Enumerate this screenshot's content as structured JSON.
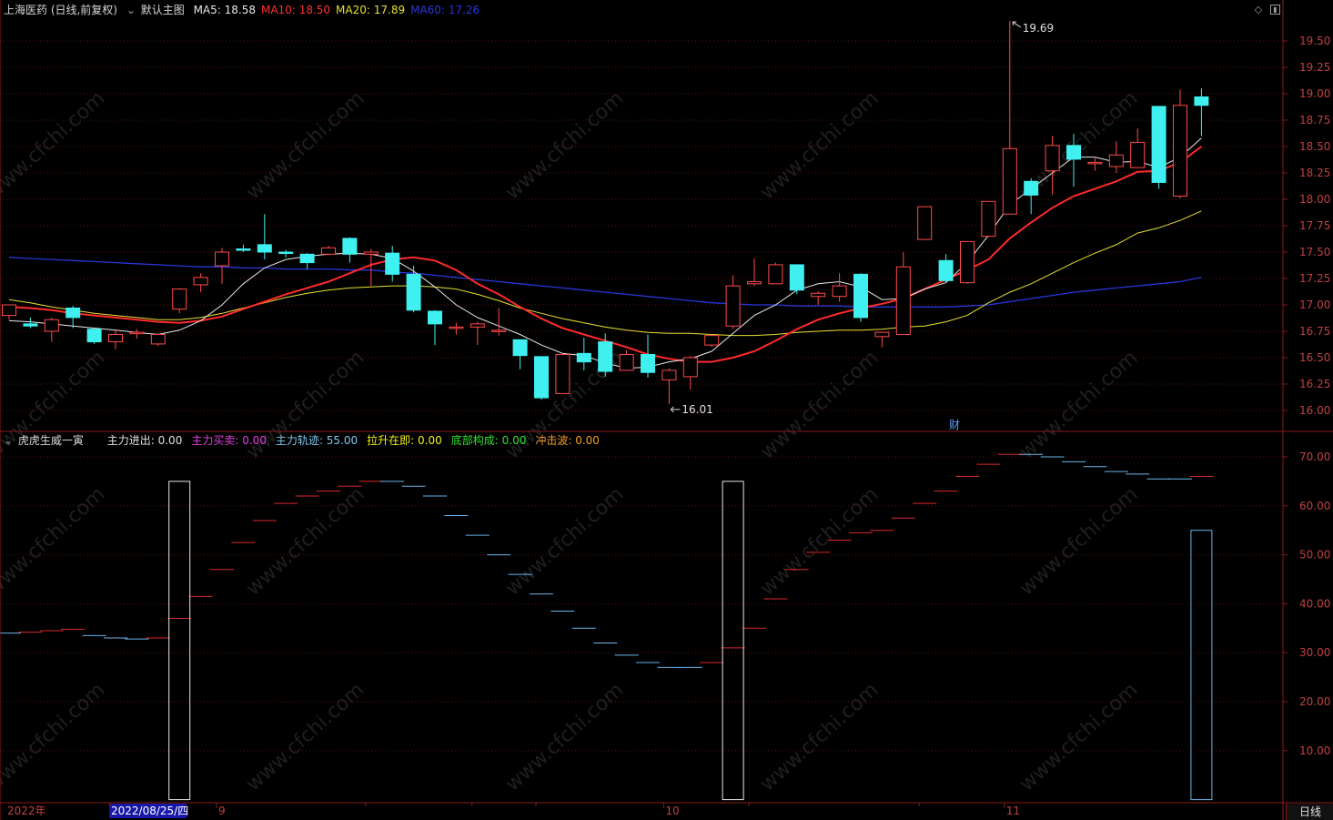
{
  "stock": {
    "title": "上海医药 (日线,前复权)",
    "main_chart_label": "默认主图",
    "ma": [
      {
        "name": "MA5",
        "value": "18.58",
        "color": "#e8e8e8"
      },
      {
        "name": "MA10",
        "value": "18.50",
        "color": "#ff3030"
      },
      {
        "name": "MA20",
        "value": "17.89",
        "color": "#e8e030"
      },
      {
        "name": "MA60",
        "value": "17.26",
        "color": "#2a36d8"
      }
    ]
  },
  "indicator": {
    "title": "虎虎生威一寅",
    "fields": [
      {
        "name": "主力进出",
        "value": "0.00",
        "color": "#e0e0e0"
      },
      {
        "name": "主力买卖",
        "value": "0.00",
        "color": "#e040e0"
      },
      {
        "name": "主力轨迹",
        "value": "55.00",
        "color": "#7ec8f0"
      },
      {
        "name": "拉升在即",
        "value": "0.00",
        "color": "#f0f020"
      },
      {
        "name": "底部构成",
        "value": "0.00",
        "color": "#30e030"
      },
      {
        "name": "冲击波",
        "value": "0.00",
        "color": "#f0a030"
      }
    ]
  },
  "annotations": {
    "high": "19.69",
    "low": "16.01",
    "finance_marker": "财"
  },
  "time_axis": {
    "year_label": "2022年",
    "cursor_date": "2022/08/25/四",
    "months": [
      "9",
      "10",
      "11"
    ],
    "period_label": "日线"
  },
  "watermark": "www.cfchi.com",
  "colors": {
    "up": "#ff4a4a",
    "down": "#40f0f0",
    "grid": "#5a1010",
    "axis": "#8b1a1a",
    "axis_text": "#c04040"
  },
  "chart_data": [
    {
      "type": "candlestick",
      "title": "上海医药 (日线,前复权)",
      "y_ticks": [
        "19.50",
        "19.25",
        "19.00",
        "18.75",
        "18.50",
        "18.25",
        "18.00",
        "17.75",
        "17.50",
        "17.25",
        "17.00",
        "16.75",
        "16.50",
        "16.25",
        "16.00"
      ],
      "ylim": [
        15.95,
        19.75
      ],
      "candles": [
        [
          16.9,
          17.0,
          16.86,
          16.98
        ],
        [
          16.82,
          16.8,
          16.78,
          16.88
        ],
        [
          16.75,
          16.86,
          16.65,
          16.88
        ],
        [
          16.97,
          16.88,
          16.78,
          16.99
        ],
        [
          16.77,
          16.65,
          16.63,
          16.77
        ],
        [
          16.65,
          16.72,
          16.58,
          16.76
        ],
        [
          16.74,
          16.74,
          16.68,
          16.77
        ],
        [
          16.63,
          16.72,
          16.61,
          16.73
        ],
        [
          16.96,
          17.15,
          16.92,
          17.16
        ],
        [
          17.19,
          17.26,
          17.12,
          17.3
        ],
        [
          17.37,
          17.5,
          17.2,
          17.54
        ],
        [
          17.53,
          17.52,
          17.5,
          17.57
        ],
        [
          17.57,
          17.5,
          17.43,
          17.86
        ],
        [
          17.5,
          17.49,
          17.45,
          17.52
        ],
        [
          17.48,
          17.4,
          17.34,
          17.49
        ],
        [
          17.48,
          17.54,
          17.47,
          17.56
        ],
        [
          17.63,
          17.48,
          17.4,
          17.64
        ],
        [
          17.48,
          17.5,
          17.18,
          17.53
        ],
        [
          17.49,
          17.29,
          17.22,
          17.56
        ],
        [
          17.29,
          16.95,
          16.93,
          17.37
        ],
        [
          16.94,
          16.82,
          16.62,
          16.95
        ],
        [
          16.78,
          16.79,
          16.72,
          16.83
        ],
        [
          16.79,
          16.82,
          16.62,
          16.84
        ],
        [
          16.76,
          16.76,
          16.71,
          16.97
        ],
        [
          16.67,
          16.52,
          16.39,
          16.67
        ],
        [
          16.51,
          16.12,
          16.1,
          16.51
        ],
        [
          16.16,
          16.53,
          16.16,
          16.54
        ],
        [
          16.54,
          16.46,
          16.38,
          16.69
        ],
        [
          16.65,
          16.37,
          16.32,
          16.73
        ],
        [
          16.38,
          16.53,
          16.38,
          16.57
        ],
        [
          16.53,
          16.36,
          16.31,
          16.72
        ],
        [
          16.29,
          16.38,
          16.06,
          16.4
        ],
        [
          16.32,
          16.5,
          16.2,
          16.52
        ],
        [
          16.62,
          16.71,
          16.6,
          16.72
        ],
        [
          16.8,
          17.18,
          16.77,
          17.28
        ],
        [
          17.2,
          17.22,
          17.18,
          17.44
        ],
        [
          17.2,
          17.38,
          17.2,
          17.4
        ],
        [
          17.38,
          17.14,
          17.1,
          17.38
        ],
        [
          17.08,
          17.11,
          17.0,
          17.13
        ],
        [
          17.08,
          17.18,
          17.03,
          17.3
        ],
        [
          17.29,
          16.88,
          16.84,
          17.3
        ],
        [
          16.7,
          16.74,
          16.6,
          16.74
        ],
        [
          16.72,
          17.36,
          16.72,
          17.5
        ],
        [
          17.62,
          17.93,
          17.62,
          17.64
        ],
        [
          17.42,
          17.23,
          17.21,
          17.48
        ],
        [
          17.21,
          17.6,
          17.2,
          17.6
        ],
        [
          17.65,
          17.98,
          17.64,
          17.98
        ],
        [
          17.86,
          18.48,
          17.86,
          19.69
        ],
        [
          18.17,
          18.04,
          17.86,
          18.2
        ],
        [
          18.27,
          18.51,
          18.04,
          18.6
        ],
        [
          18.51,
          18.38,
          18.12,
          18.62
        ],
        [
          18.35,
          18.35,
          18.27,
          18.4
        ],
        [
          18.31,
          18.42,
          18.25,
          18.55
        ],
        [
          18.3,
          18.54,
          18.3,
          18.67
        ],
        [
          18.88,
          18.16,
          18.1,
          18.88
        ],
        [
          18.03,
          18.89,
          18.01,
          19.04
        ],
        [
          18.97,
          18.89,
          18.6,
          19.05
        ]
      ],
      "ma_series": {
        "MA5": [
          16.85,
          16.84,
          16.82,
          16.8,
          16.78,
          16.76,
          16.74,
          16.72,
          16.76,
          16.85,
          17.0,
          17.2,
          17.35,
          17.43,
          17.46,
          17.48,
          17.49,
          17.48,
          17.44,
          17.32,
          17.17,
          17.0,
          16.88,
          16.8,
          16.72,
          16.62,
          16.54,
          16.52,
          16.45,
          16.4,
          16.41,
          16.46,
          16.49,
          16.56,
          16.73,
          16.9,
          17.0,
          17.14,
          17.2,
          17.22,
          17.17,
          17.05,
          17.06,
          17.15,
          17.21,
          17.4,
          17.66,
          17.95,
          18.1,
          18.25,
          18.4,
          18.4,
          18.35,
          18.36,
          18.3,
          18.4,
          18.58
        ],
        "MA10": [
          16.98,
          16.97,
          16.95,
          16.92,
          16.9,
          16.88,
          16.86,
          16.84,
          16.83,
          16.85,
          16.89,
          16.96,
          17.03,
          17.1,
          17.16,
          17.22,
          17.3,
          17.38,
          17.43,
          17.45,
          17.42,
          17.33,
          17.2,
          17.1,
          16.98,
          16.87,
          16.78,
          16.72,
          16.66,
          16.6,
          16.53,
          16.49,
          16.46,
          16.46,
          16.5,
          16.56,
          16.66,
          16.77,
          16.86,
          16.92,
          16.97,
          17.01,
          17.06,
          17.15,
          17.24,
          17.33,
          17.43,
          17.63,
          17.78,
          17.92,
          18.03,
          18.1,
          18.17,
          18.26,
          18.27,
          18.35,
          18.5
        ],
        "MA20": [
          17.05,
          17.02,
          16.98,
          16.95,
          16.92,
          16.9,
          16.88,
          16.86,
          16.86,
          16.88,
          16.92,
          16.97,
          17.02,
          17.07,
          17.11,
          17.14,
          17.16,
          17.17,
          17.18,
          17.18,
          17.17,
          17.15,
          17.1,
          17.04,
          16.97,
          16.92,
          16.87,
          16.83,
          16.79,
          16.76,
          16.74,
          16.73,
          16.73,
          16.72,
          16.71,
          16.71,
          16.72,
          16.74,
          16.75,
          16.76,
          16.76,
          16.77,
          16.79,
          16.8,
          16.84,
          16.9,
          17.02,
          17.12,
          17.2,
          17.3,
          17.4,
          17.49,
          17.57,
          17.68,
          17.73,
          17.8,
          17.89
        ],
        "MA60": [
          17.45,
          17.44,
          17.43,
          17.42,
          17.41,
          17.4,
          17.39,
          17.38,
          17.37,
          17.36,
          17.36,
          17.35,
          17.35,
          17.34,
          17.34,
          17.34,
          17.33,
          17.33,
          17.31,
          17.3,
          17.28,
          17.26,
          17.24,
          17.22,
          17.2,
          17.18,
          17.16,
          17.14,
          17.12,
          17.1,
          17.08,
          17.06,
          17.04,
          17.02,
          17.01,
          17.0,
          17.0,
          16.99,
          16.99,
          16.99,
          16.98,
          16.98,
          16.98,
          16.98,
          16.98,
          16.99,
          17.0,
          17.03,
          17.06,
          17.09,
          17.12,
          17.14,
          17.16,
          17.18,
          17.2,
          17.22,
          17.26
        ]
      }
    },
    {
      "type": "bar",
      "title": "虎虎生威一寅",
      "y_ticks": [
        "70.00",
        "60.00",
        "50.00",
        "40.00",
        "30.00",
        "20.00",
        "10.00"
      ],
      "ylim": [
        0,
        75
      ],
      "trajectory": [
        34,
        34.2,
        34.5,
        34.8,
        33.5,
        33,
        32.8,
        33,
        37,
        41.5,
        47,
        52.5,
        57,
        60.5,
        62,
        63,
        64,
        65,
        65,
        64,
        62,
        58,
        54,
        50,
        46,
        42,
        38.5,
        35,
        32,
        29.5,
        28,
        27,
        27,
        28,
        31,
        35,
        41,
        47,
        50.5,
        53,
        54.5,
        55,
        57.5,
        60.5,
        63,
        66,
        68.5,
        70.5,
        70.5,
        70,
        69,
        68,
        67,
        66.5,
        65.5,
        65.5,
        66
      ],
      "trajectory_rising": [
        false,
        true,
        true,
        true,
        false,
        false,
        false,
        true,
        true,
        true,
        true,
        true,
        true,
        true,
        true,
        true,
        true,
        true,
        false,
        false,
        false,
        false,
        false,
        false,
        false,
        false,
        false,
        false,
        false,
        false,
        false,
        false,
        false,
        true,
        true,
        true,
        true,
        true,
        true,
        true,
        true,
        true,
        true,
        true,
        true,
        true,
        true,
        true,
        false,
        false,
        false,
        false,
        false,
        false,
        false,
        false,
        true
      ],
      "signals": [
        {
          "index": 8,
          "value": 65
        },
        {
          "index": 34,
          "value": 65
        },
        {
          "index": 56,
          "value": 55
        }
      ]
    }
  ]
}
